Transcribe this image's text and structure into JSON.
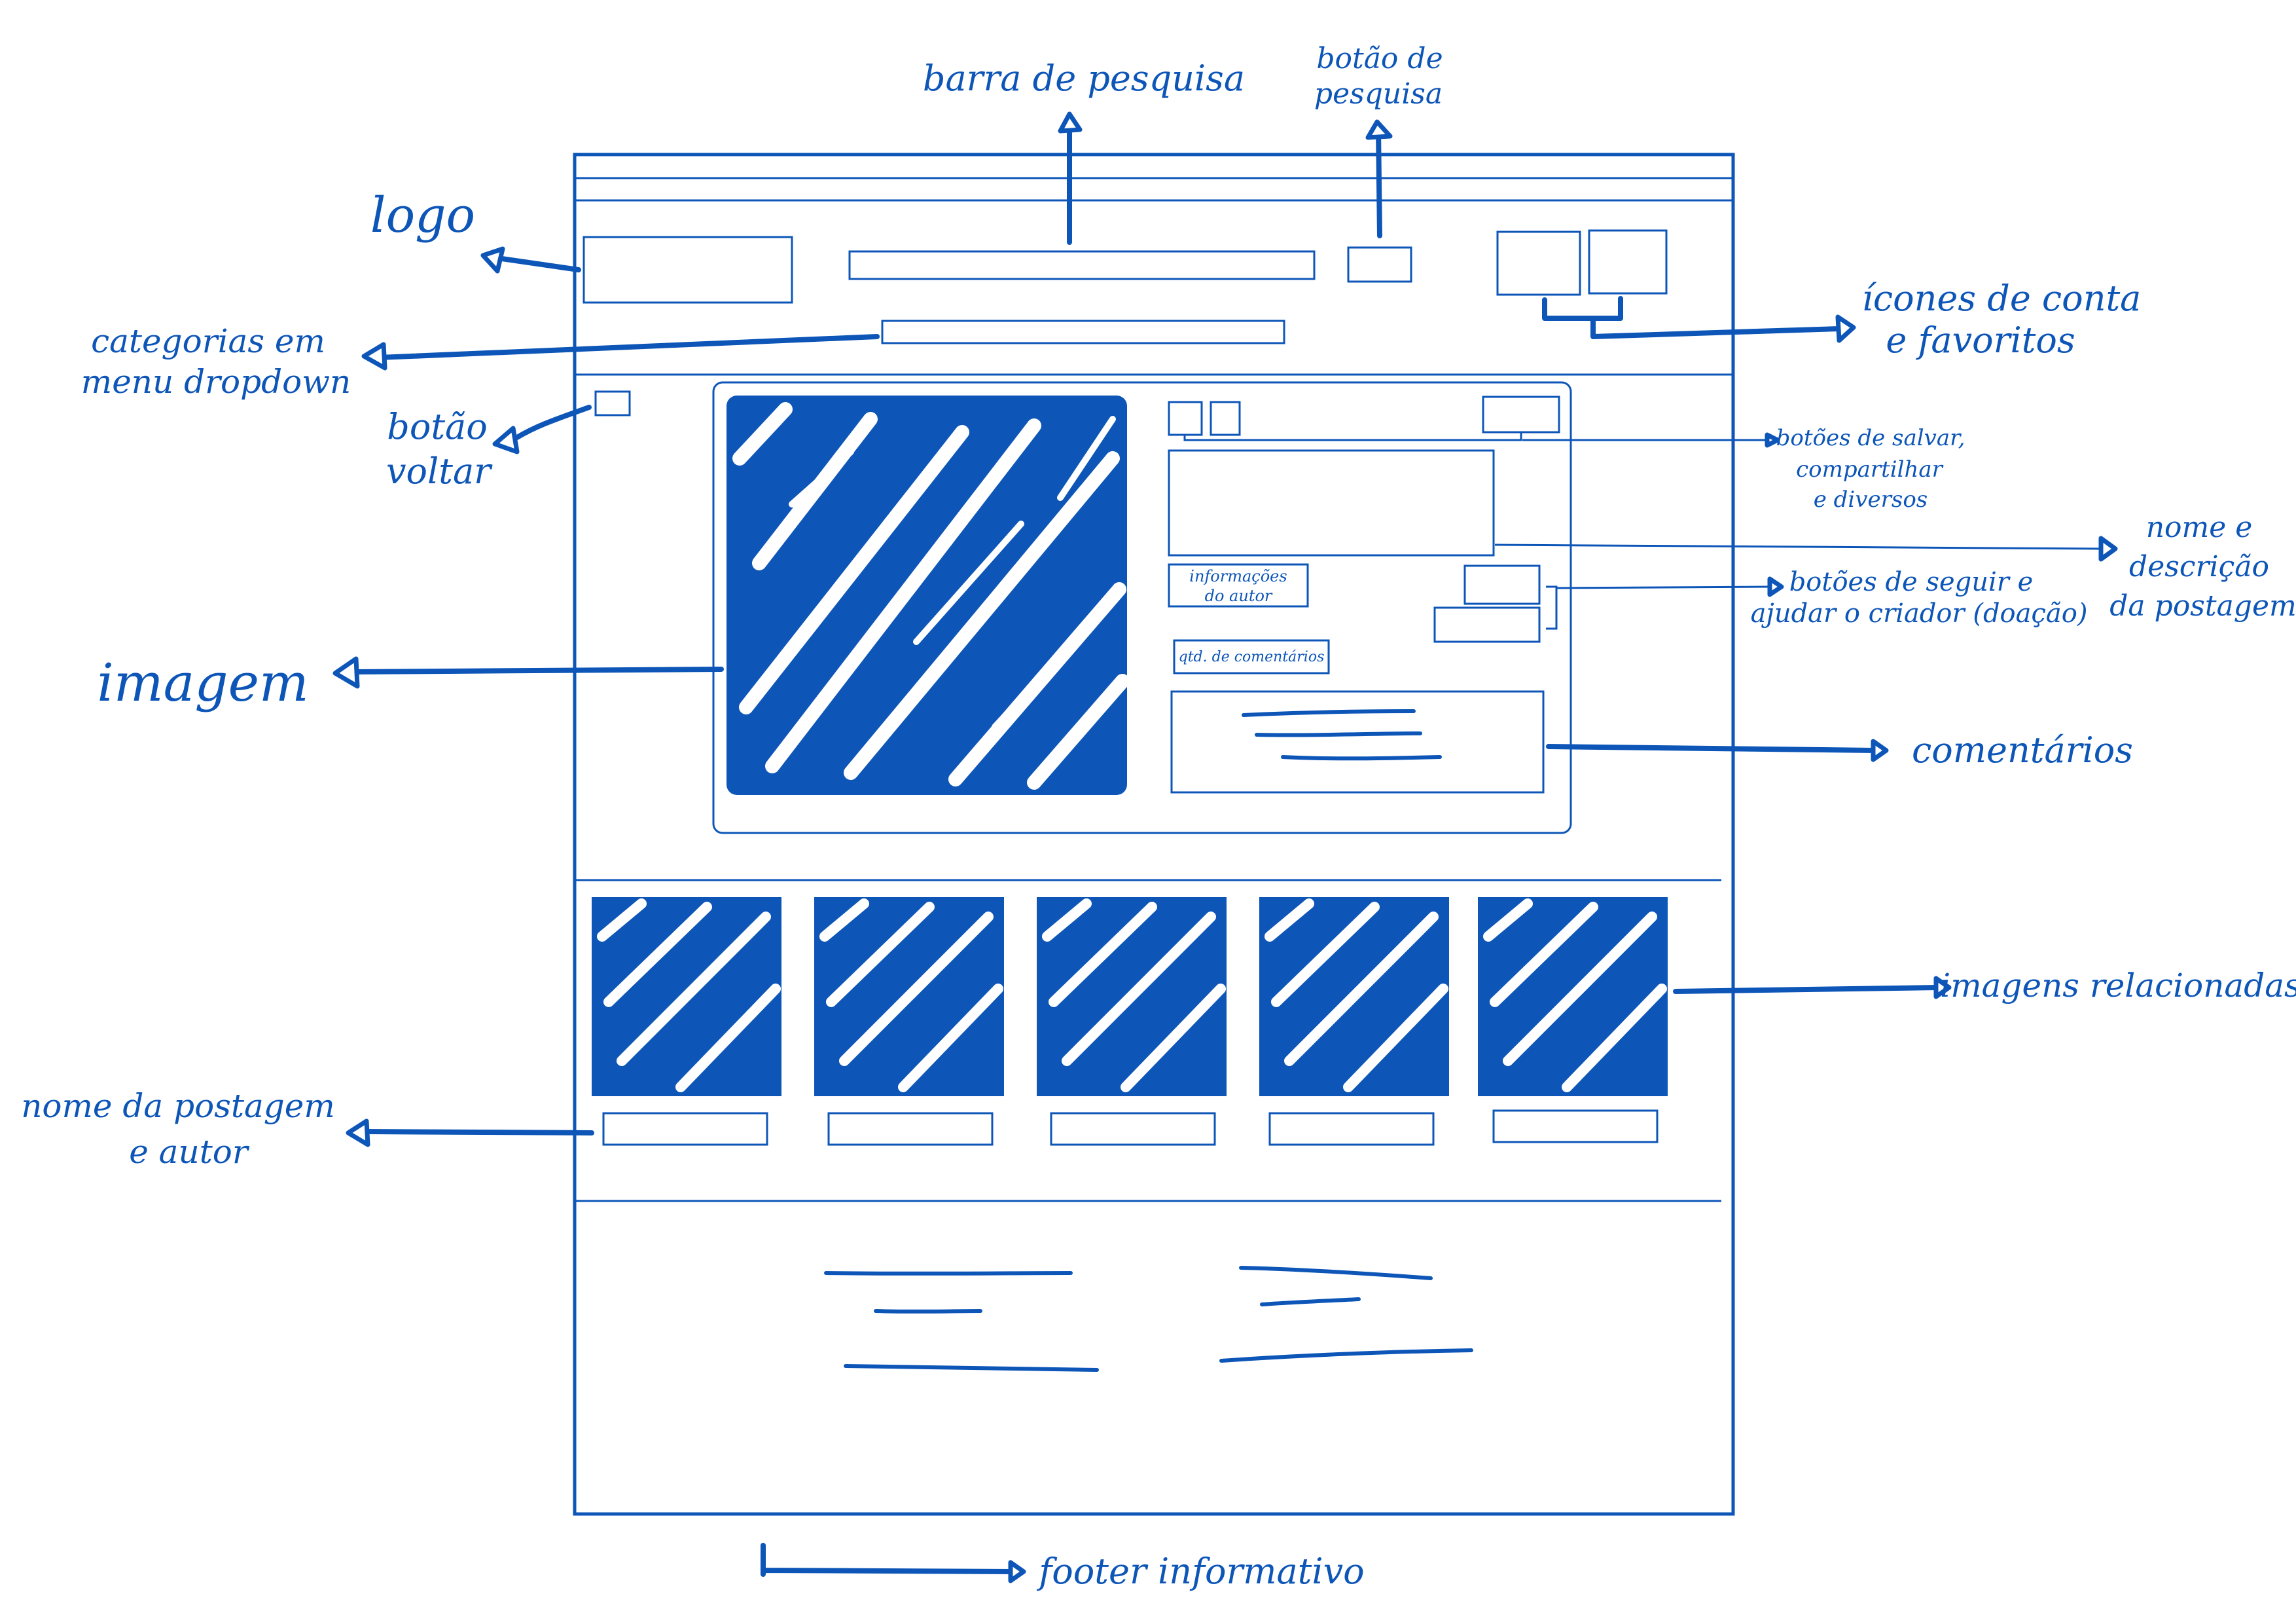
{
  "annotations": {
    "barra_pesquisa": "barra de pesquisa",
    "botao_pesquisa_1": "botão de",
    "botao_pesquisa_2": "pesquisa",
    "logo": "logo",
    "icones_1": "ícones de conta",
    "icones_2": "e favoritos",
    "categorias_1": "categorias em",
    "categorias_2": "menu dropdown",
    "voltar_1": "botão",
    "voltar_2": "voltar",
    "botoes_salvar_1": "botões de salvar,",
    "botoes_salvar_2": "compartilhar",
    "botoes_salvar_3": "e diversos",
    "nome_desc_1": "nome e",
    "nome_desc_2": "descrição",
    "nome_desc_3": "da postagem",
    "seguir_1": "botões de seguir e",
    "seguir_2": "ajudar o criador (doação)",
    "imagem": "imagem",
    "comentarios": "comentários",
    "imagens_relacionadas": "imagens relacionadas",
    "nome_postagem_1": "nome da postagem",
    "nome_postagem_2": "e autor",
    "footer": "footer informativo"
  },
  "inner_labels": {
    "autor_1": "informações",
    "autor_2": "do autor",
    "qtd_comentarios": "qtd. de comentários"
  },
  "colors": {
    "ink": "#0d56b8",
    "paper": "#ffffff"
  }
}
